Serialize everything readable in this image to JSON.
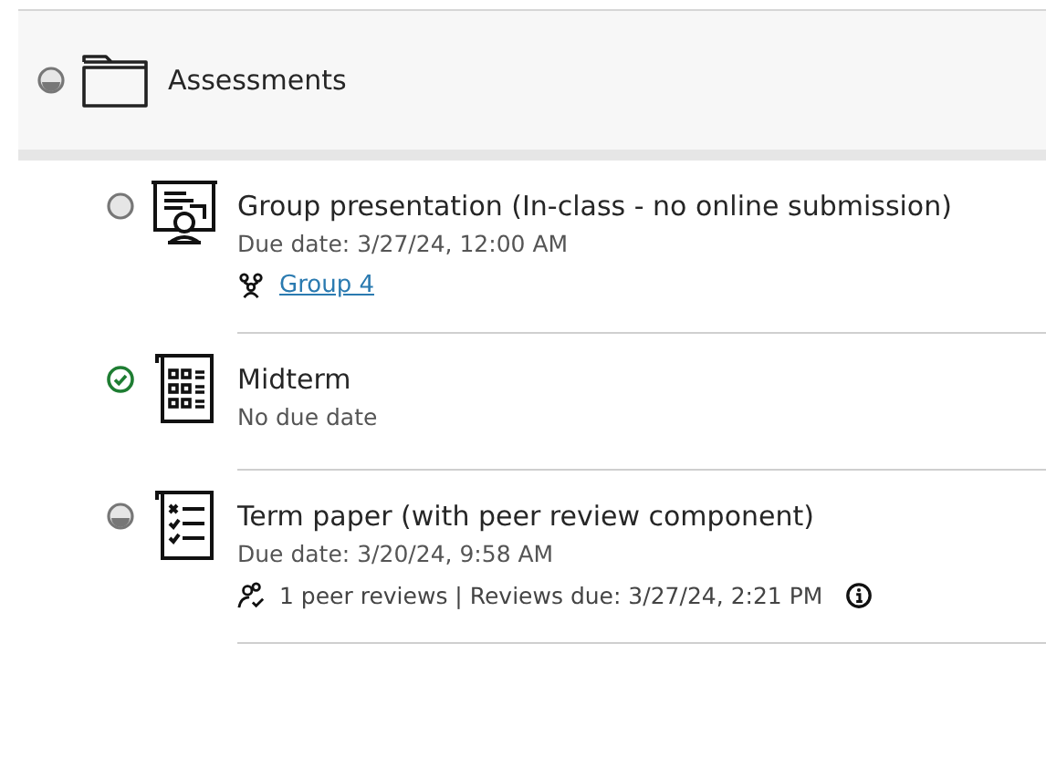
{
  "folder": {
    "title": "Assessments",
    "started": true,
    "completed": false
  },
  "items": [
    {
      "kind": "presentation",
      "title": "Group presentation (In-class - no online submission)",
      "started": false,
      "completed": false,
      "due": "Due date: 3/27/24, 12:00 AM",
      "extra": {
        "kind": "group",
        "text": "Group 4"
      }
    },
    {
      "kind": "test",
      "title": "Midterm",
      "started": true,
      "completed": true,
      "due": "No due date"
    },
    {
      "kind": "paper",
      "title": "Term paper (with peer review component)",
      "started": true,
      "completed": false,
      "due": "Due date: 3/20/24, 9:58 AM",
      "extra": {
        "kind": "peer_review",
        "text": "1 peer reviews | Reviews due: 3/27/24, 2:21 PM"
      }
    }
  ]
}
